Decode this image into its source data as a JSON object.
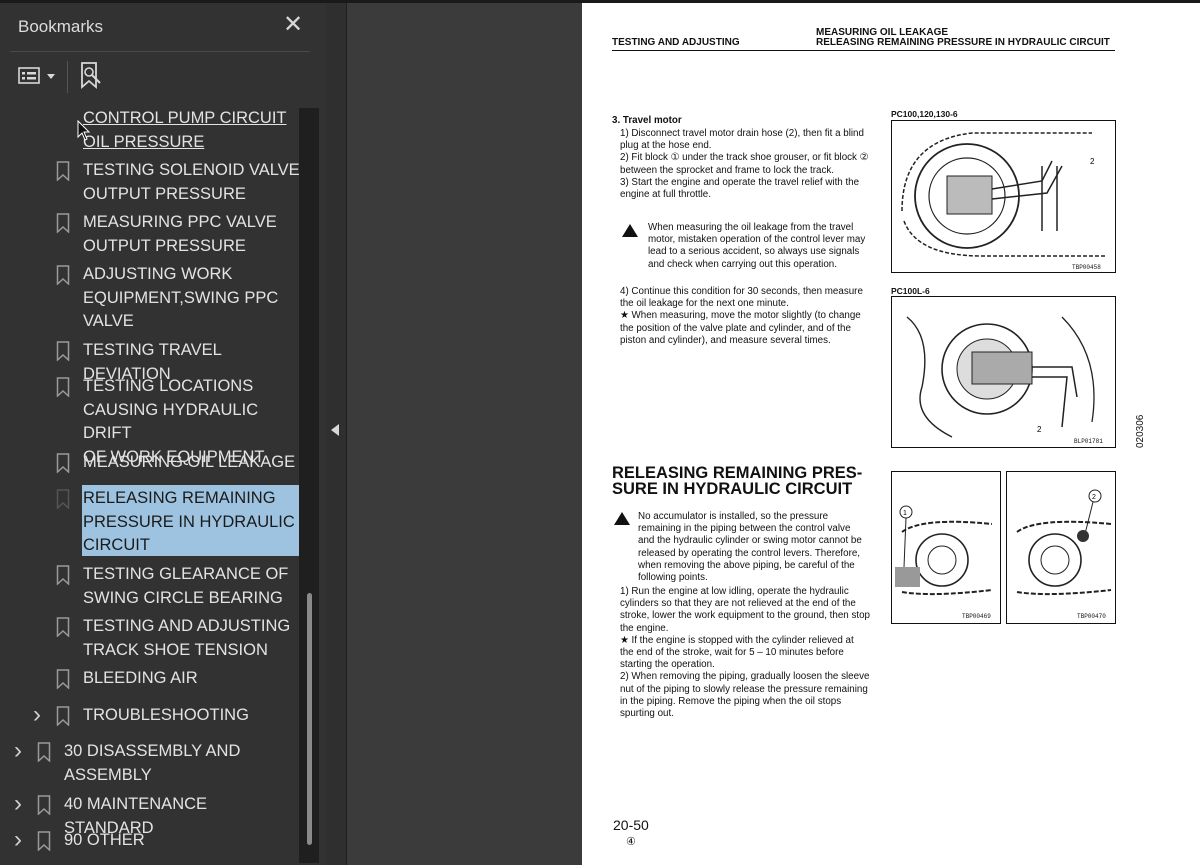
{
  "sidebar": {
    "title": "Bookmarks",
    "close_glyph": "✕",
    "toolbar": {
      "options_icon": "list-options-icon",
      "find_icon": "find-bookmark-icon"
    },
    "items": [
      {
        "label_lines": [
          "CONTROL PUMP CIRCUIT",
          "OIL PRESSURE"
        ],
        "level": 2,
        "link": true
      },
      {
        "label_lines": [
          "TESTING SOLENOID VALVE",
          "OUTPUT PRESSURE"
        ],
        "level": 2
      },
      {
        "label_lines": [
          "MEASURING PPC VALVE",
          "OUTPUT PRESSURE"
        ],
        "level": 2
      },
      {
        "label_lines": [
          "ADJUSTING WORK",
          "EQUIPMENT,SWING PPC",
          "VALVE"
        ],
        "level": 2
      },
      {
        "label_lines": [
          "TESTING TRAVEL DEVIATION"
        ],
        "level": 2
      },
      {
        "label_lines": [
          "TESTING LOCATIONS",
          "CAUSING HYDRAULIC DRIFT",
          "OF WORK EQUIPMENT"
        ],
        "level": 2
      },
      {
        "label_lines": [
          "MEASURING OIL LEAKAGE"
        ],
        "level": 2
      },
      {
        "label_lines": [
          "RELEASING REMAINING",
          "PRESSURE IN HYDRAULIC",
          "CIRCUIT"
        ],
        "level": 2,
        "selected": true
      },
      {
        "label_lines": [
          "TESTING GLEARANCE OF",
          "SWING CIRCLE BEARING"
        ],
        "level": 2
      },
      {
        "label_lines": [
          "TESTING AND ADJUSTING",
          "TRACK SHOE TENSION"
        ],
        "level": 2
      },
      {
        "label_lines": [
          "BLEEDING AIR"
        ],
        "level": 2
      },
      {
        "label_lines": [
          "TROUBLESHOOTING"
        ],
        "level": 1,
        "expandable": true
      },
      {
        "label_lines": [
          "30 DISASSEMBLY AND",
          "ASSEMBLY"
        ],
        "level": 0,
        "expandable": true
      },
      {
        "label_lines": [
          "40 MAINTENANCE STANDARD"
        ],
        "level": 0,
        "expandable": true
      },
      {
        "label_lines": [
          "90 OTHER"
        ],
        "level": 0,
        "expandable": true
      }
    ]
  },
  "document": {
    "header_left": "TESTING AND ADJUSTING",
    "header_right_1": "MEASURING OIL LEAKAGE",
    "header_right_2": "RELEASING REMAINING PRESSURE IN HYDRAULIC CIRCUIT",
    "section3_title": "3.  Travel motor",
    "travel_steps": [
      "1)  Disconnect travel motor drain hose (2), then fit a blind plug at the hose end.",
      "2)  Fit block ① under the track shoe grouser, or fit block ② between the sprocket and frame to lock the track.",
      "3)  Start the engine and operate the travel relief with the engine at full throttle."
    ],
    "travel_warning": "When measuring the oil leakage from the travel motor, mistaken operation of the control lever may lead to a serious accident, so always use signals and check when carrying out this operation.",
    "travel_steps_b": [
      "4)  Continue this condition for 30 seconds, then measure the oil leakage for the next one minute.",
      "★  When measuring, move the motor slightly (to change the position of the valve plate and cylinder, and of the piston and cylinder), and measure several times."
    ],
    "fig1_caption": "PC100,120,130-6",
    "fig1_code": "TBP00458",
    "fig2_caption": "PC100L-6",
    "fig2_code": "BLP01781",
    "release_title_1": "RELEASING REMAINING PRES-",
    "release_title_2": "SURE IN HYDRAULIC CIRCUIT",
    "release_warning": "No accumulator is installed, so the pressure remaining in the piping between the control valve and the hydraulic cylinder or swing motor cannot be released by operating the control levers. Therefore, when removing the above piping, be careful of the following points.",
    "release_steps": [
      "1)  Run the engine at low idling, operate the hydraulic cylinders so that they are not relieved at the end of the stroke, lower the work equipment to the ground, then stop the engine.",
      "★  If the engine is stopped with the cylinder relieved at the end of the stroke, wait for 5 – 10 minutes before starting the operation.",
      "2)  When removing the piping, gradually loosen the sleeve nut of the piping to slowly release the pressure remaining in the piping. Remove the piping when the oil stops spurting out."
    ],
    "fig3_code": "TBP00469",
    "fig4_code": "TBP00470",
    "page_number": "20-50",
    "page_sub": "④",
    "side_code": "020306"
  }
}
